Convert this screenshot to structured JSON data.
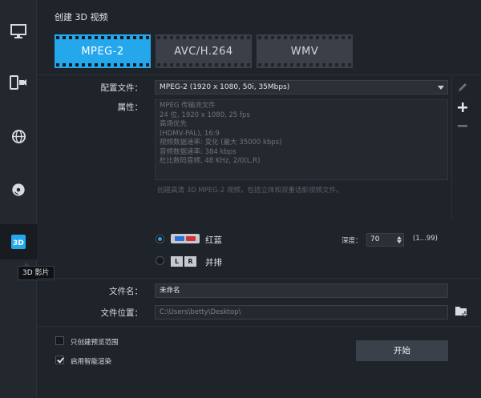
{
  "window": {
    "title": "创建 3D 视频"
  },
  "sidebar": {
    "items": [
      {
        "icon": "monitor-icon"
      },
      {
        "icon": "device-camera-icon"
      },
      {
        "icon": "globe-icon"
      },
      {
        "icon": "disc-icon"
      },
      {
        "icon": "3d-movie-icon",
        "active": true
      }
    ],
    "tooltip": "3D 影片"
  },
  "format_tabs": [
    {
      "label": "MPEG-2",
      "selected": true
    },
    {
      "label": "AVC/H.264",
      "selected": false
    },
    {
      "label": "WMV",
      "selected": false
    }
  ],
  "profile": {
    "label": "配置文件：",
    "value": "MPEG-2 (1920 x 1080, 50i, 35Mbps)"
  },
  "properties": {
    "label": "属性：",
    "lines": [
      "MPEG 传输流文件",
      "24 位, 1920 x 1080, 25 fps",
      "高场优先",
      "(HDMV-PAL), 16:9",
      "视频数据速率: 变化 (最大 35000 kbps)",
      "音频数据速率: 384 kbps",
      "杜比数码音频, 48 KHz, 2/0(L,R)"
    ],
    "description": "创建高清 3D MPEG-2 视频，包括立体和双重话影视频文件。"
  },
  "stereo_options": {
    "anaglyph_label": "红蓝",
    "side_by_side_label": "并排",
    "lr_left": "L",
    "lr_right": "R",
    "selected": "anaglyph",
    "depth_label": "深度：",
    "depth_value": "70",
    "depth_range": "(1...99)"
  },
  "output": {
    "filename_label": "文件名：",
    "filename_value": "未命名",
    "location_label": "文件位置：",
    "location_value": "C:\\Users\\betty\\Desktop\\"
  },
  "options": {
    "preview_only_label": "只创建预览范围",
    "preview_only_checked": false,
    "smart_render_label": "启用智能渲染",
    "smart_render_checked": true
  },
  "start_button": "开始",
  "colors": {
    "accent": "#25a7ec",
    "background": "#1f232a"
  }
}
